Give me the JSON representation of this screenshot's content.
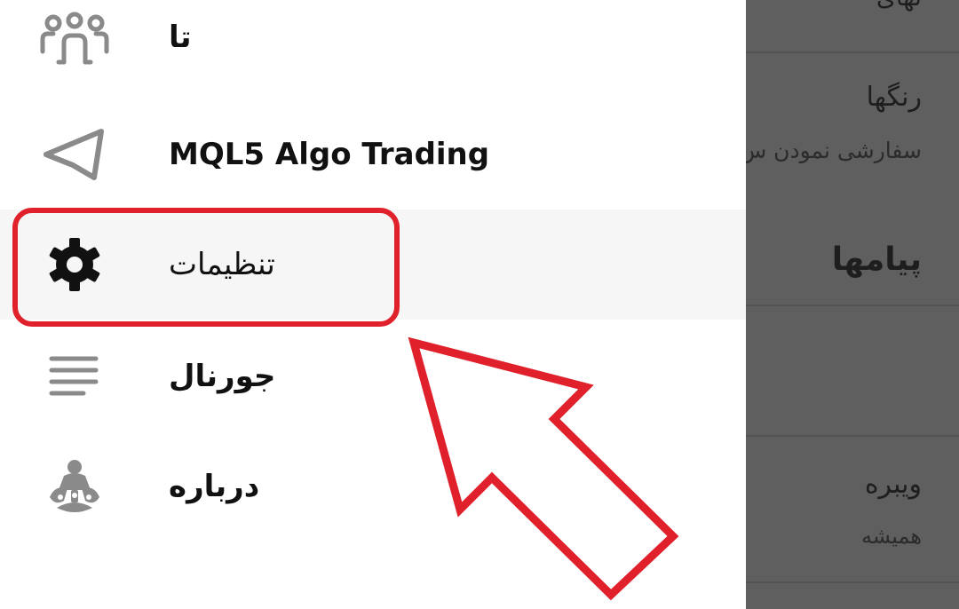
{
  "drawer": {
    "items": [
      {
        "label": "تا",
        "icon": "people-group-icon"
      },
      {
        "label": "MQL5 Algo Trading",
        "icon": "telegram-send-icon"
      },
      {
        "label": "تنظیمات",
        "icon": "gear-icon",
        "selected": true
      },
      {
        "label": "جورنال",
        "icon": "journal-lines-icon"
      },
      {
        "label": "درباره",
        "icon": "metaquotes-logo-icon"
      }
    ]
  },
  "background": {
    "top_partial": "نهای",
    "colors_title": "رنگها",
    "colors_subtitle": "سفارشی نمودن س",
    "messages_title": "پیامها",
    "vibration_title": "ویبره",
    "vibration_subtitle": "همیشه"
  },
  "colors": {
    "highlight": "#e0202a",
    "overlay": "#5f5f5f"
  }
}
